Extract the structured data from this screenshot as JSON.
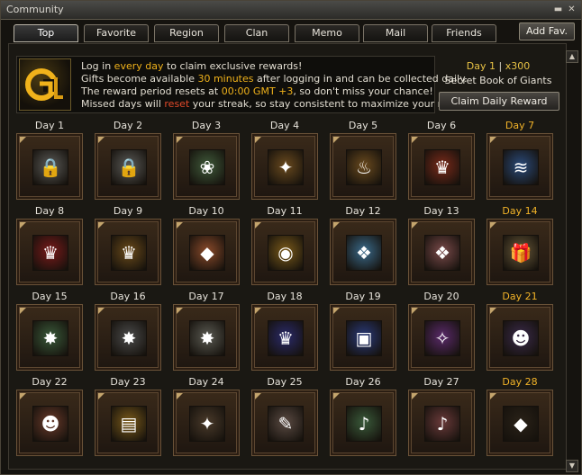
{
  "window": {
    "title": "Community"
  },
  "tabs": [
    "Top",
    "Favorite",
    "Region",
    "Clan",
    "Memo",
    "Mail",
    "Friends"
  ],
  "add_fav": "Add Fav.",
  "info": {
    "line1": [
      "Log in ",
      "every day",
      " to claim exclusive rewards!"
    ],
    "line2": [
      "Gifts become available ",
      "30 minutes",
      " after logging in and can be collected daily."
    ],
    "line3": [
      "The reward period resets at ",
      "00:00 GMT +3",
      ", so don't miss your chance!"
    ],
    "line4": [
      "Missed days will ",
      "reset",
      " your streak, so stay consistent to maximize your rewards!"
    ]
  },
  "reward": {
    "day": "Day 1",
    "separator": "|",
    "qty": "x300",
    "name": "Secret Book of Giants",
    "claim": "Claim Daily Reward"
  },
  "colors": {
    "highlight": "#f0b21b",
    "reset_red": "#e24a2a",
    "special_day": "#f2b328"
  },
  "days": [
    {
      "label": "Day 1",
      "icon": "lock-icon",
      "glyph": "🔒",
      "bg": "#5b5b58",
      "special": false
    },
    {
      "label": "Day 2",
      "icon": "lock-icon",
      "glyph": "🔒",
      "bg": "#5b5b58",
      "special": false
    },
    {
      "label": "Day 3",
      "icon": "herb-icon",
      "glyph": "❀",
      "bg": "#3f5a3a",
      "special": false
    },
    {
      "label": "Day 4",
      "icon": "gold-pile-icon",
      "glyph": "✦",
      "bg": "#6a4a1e",
      "special": false
    },
    {
      "label": "Day 5",
      "icon": "lamp-icon",
      "glyph": "♨",
      "bg": "#6a4a1e",
      "special": false
    },
    {
      "label": "Day 6",
      "icon": "crown-icon",
      "glyph": "♛",
      "bg": "#7a2a1a",
      "special": false
    },
    {
      "label": "Day 7",
      "icon": "book-icon",
      "glyph": "≋",
      "bg": "#2a4a7a",
      "special": true
    },
    {
      "label": "Day 8",
      "icon": "crown-icon",
      "glyph": "♛",
      "bg": "#7a1a1a",
      "special": false
    },
    {
      "label": "Day 9",
      "icon": "crown-icon",
      "glyph": "♛",
      "bg": "#6a4a1a",
      "special": false
    },
    {
      "label": "Day 10",
      "icon": "gem-icon",
      "glyph": "◆",
      "bg": "#8a4a2a",
      "special": false
    },
    {
      "label": "Day 11",
      "icon": "coin-icon",
      "glyph": "◉",
      "bg": "#7a5a1a",
      "special": false
    },
    {
      "label": "Day 12",
      "icon": "crystal-box-icon",
      "glyph": "❖",
      "bg": "#3a6a8a",
      "special": false
    },
    {
      "label": "Day 13",
      "icon": "rose-box-icon",
      "glyph": "❖",
      "bg": "#7a4a4a",
      "special": false
    },
    {
      "label": "Day 14",
      "icon": "gift-box-icon",
      "glyph": "🎁",
      "bg": "#6a5a3a",
      "special": true
    },
    {
      "label": "Day 15",
      "icon": "green-book-icon",
      "glyph": "✸",
      "bg": "#3a5a3a",
      "special": false
    },
    {
      "label": "Day 16",
      "icon": "grey-book-icon",
      "glyph": "✸",
      "bg": "#4a4a4a",
      "special": false
    },
    {
      "label": "Day 17",
      "icon": "scroll-book-icon",
      "glyph": "✸",
      "bg": "#5a5a52",
      "special": false
    },
    {
      "label": "Day 18",
      "icon": "crown-icon",
      "glyph": "♛",
      "bg": "#2a2a6a",
      "special": false
    },
    {
      "label": "Day 19",
      "icon": "blue-cubes-icon",
      "glyph": "▣",
      "bg": "#2a3a7a",
      "special": false
    },
    {
      "label": "Day 20",
      "icon": "rune-icon",
      "glyph": "✧",
      "bg": "#5a2a6a",
      "special": false
    },
    {
      "label": "Day 21",
      "icon": "grin-mask-icon",
      "glyph": "☻",
      "bg": "#3a2a4a",
      "special": true
    },
    {
      "label": "Day 22",
      "icon": "grin-mask-icon",
      "glyph": "☻",
      "bg": "#6a3a2a",
      "special": false
    },
    {
      "label": "Day 23",
      "icon": "gold-chest-icon",
      "glyph": "▤",
      "bg": "#7a5a1a",
      "special": false
    },
    {
      "label": "Day 24",
      "icon": "jewel-chest-icon",
      "glyph": "✦",
      "bg": "#4a3a2a",
      "special": false
    },
    {
      "label": "Day 25",
      "icon": "scroll-icon",
      "glyph": "✎",
      "bg": "#5a4a42",
      "special": false
    },
    {
      "label": "Day 26",
      "icon": "horn-icon",
      "glyph": "♪",
      "bg": "#3a5a3a",
      "special": false
    },
    {
      "label": "Day 27",
      "icon": "red-horn-icon",
      "glyph": "♪",
      "bg": "#6a3a3a",
      "special": false
    },
    {
      "label": "Day 28",
      "icon": "diamond-icon",
      "glyph": "◆",
      "bg": "#2a2218",
      "special": true
    }
  ]
}
